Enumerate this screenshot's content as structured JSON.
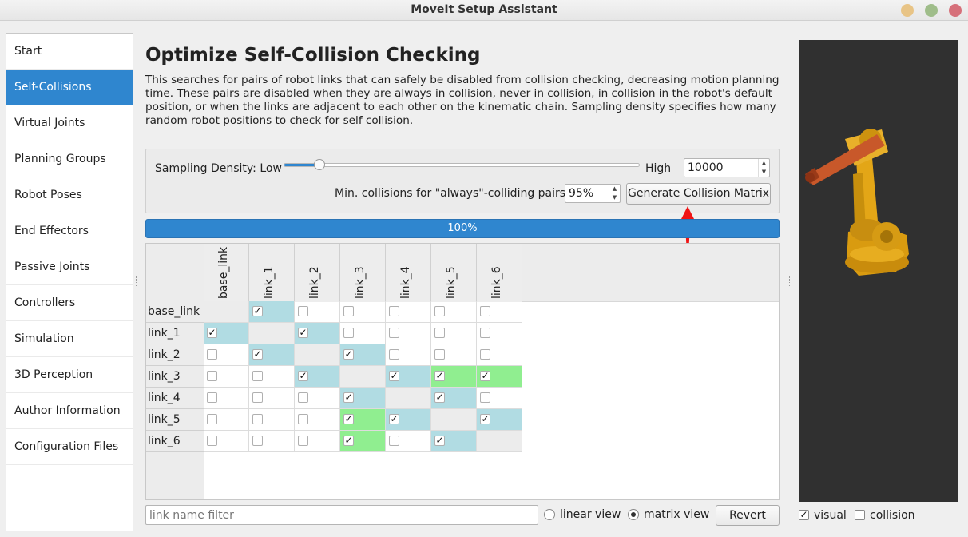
{
  "window": {
    "title": "MoveIt Setup Assistant"
  },
  "sidebar": {
    "items": [
      {
        "label": "Start"
      },
      {
        "label": "Self-Collisions"
      },
      {
        "label": "Virtual Joints"
      },
      {
        "label": "Planning Groups"
      },
      {
        "label": "Robot Poses"
      },
      {
        "label": "End Effectors"
      },
      {
        "label": "Passive Joints"
      },
      {
        "label": "Controllers"
      },
      {
        "label": "Simulation"
      },
      {
        "label": "3D Perception"
      },
      {
        "label": "Author Information"
      },
      {
        "label": "Configuration Files"
      }
    ],
    "active_index": 1
  },
  "page": {
    "title": "Optimize Self-Collision Checking",
    "description": "This searches for pairs of robot links that can safely be disabled from collision checking, decreasing motion planning time. These pairs are disabled when they are always in collision, never in collision, in collision in the robot's default position, or when the links are adjacent to each other on the kinematic chain. Sampling density specifies how many random robot positions to check for self collision."
  },
  "controls": {
    "density_label": "Sampling Density: Low",
    "high_label": "High",
    "density_slider_fraction": 0.1,
    "density_value": "10000",
    "min_collisions_label": "Min. collisions for \"always\"-colliding pairs:",
    "min_collisions_value": "95%",
    "generate_button": "Generate Collision Matrix"
  },
  "progress": {
    "text": "100%",
    "fraction": 1.0
  },
  "matrix": {
    "links": [
      "base_link",
      "link_1",
      "link_2",
      "link_3",
      "link_4",
      "link_5",
      "link_6"
    ],
    "checked": [
      [
        0,
        1,
        0,
        0,
        0,
        0,
        0
      ],
      [
        1,
        0,
        1,
        0,
        0,
        0,
        0
      ],
      [
        0,
        1,
        0,
        1,
        0,
        0,
        0
      ],
      [
        0,
        0,
        1,
        0,
        1,
        1,
        1
      ],
      [
        0,
        0,
        0,
        1,
        0,
        1,
        0
      ],
      [
        0,
        0,
        0,
        1,
        1,
        0,
        1
      ],
      [
        0,
        0,
        0,
        1,
        0,
        1,
        0
      ]
    ],
    "highlight": [
      [
        "-",
        "blue",
        "",
        "",
        "",
        "",
        ""
      ],
      [
        "blue",
        "-",
        "blue",
        "",
        "",
        "",
        ""
      ],
      [
        "",
        "blue",
        "-",
        "blue",
        "",
        "",
        ""
      ],
      [
        "",
        "",
        "blue",
        "-",
        "blue",
        "green",
        "green"
      ],
      [
        "",
        "",
        "",
        "blue",
        "-",
        "blue",
        ""
      ],
      [
        "",
        "",
        "",
        "green",
        "blue",
        "-",
        "blue"
      ],
      [
        "",
        "",
        "",
        "green",
        "",
        "blue",
        "-"
      ]
    ],
    "colors": {
      "blue": "#b1dce3",
      "green": "#90ee90",
      "diagonal": "#ececec"
    }
  },
  "footer": {
    "filter_placeholder": "link name filter",
    "linear_view": "linear view",
    "matrix_view": "matrix view",
    "selected_view": "matrix",
    "revert_button": "Revert"
  },
  "viewport": {
    "visual_label": "visual",
    "visual_checked": true,
    "collision_label": "collision",
    "collision_checked": false
  },
  "colors": {
    "accent": "#2f86cf",
    "robot": "#e0a818",
    "robot_arm": "#c8582a",
    "viewport_bg": "#303030"
  }
}
